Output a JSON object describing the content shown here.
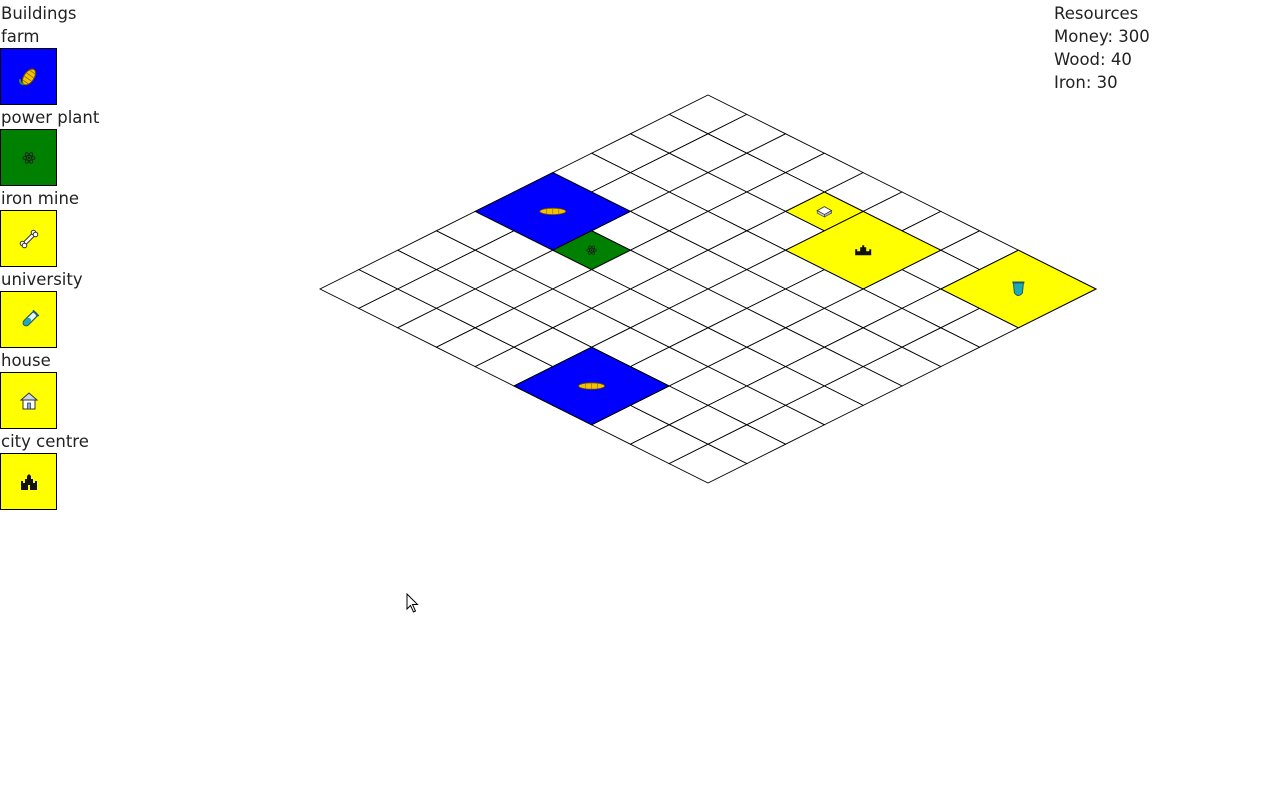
{
  "buildings": {
    "title": "Buildings",
    "items": [
      {
        "key": "farm",
        "label": "farm",
        "color": "#0000ff",
        "icon": "corn-icon"
      },
      {
        "key": "power-plant",
        "label": "power plant",
        "color": "#008000",
        "icon": "atom-icon"
      },
      {
        "key": "iron-mine",
        "label": "iron mine",
        "color": "#ffff00",
        "icon": "bone-icon"
      },
      {
        "key": "university",
        "label": "university",
        "color": "#ffff00",
        "icon": "test-tube-icon"
      },
      {
        "key": "house",
        "label": "house",
        "color": "#ffff00",
        "icon": "house-icon"
      },
      {
        "key": "city-centre",
        "label": "city centre",
        "color": "#ffff00",
        "icon": "castle-icon"
      }
    ]
  },
  "resources": {
    "title": "Resources",
    "money": "Money: 300",
    "wood": "Wood: 40",
    "iron": "Iron: 30"
  },
  "board": {
    "grid_size": 10,
    "placed": [
      {
        "building": "farm",
        "row": 4,
        "col": 0,
        "span": 2
      },
      {
        "building": "power-plant",
        "row": 5,
        "col": 2,
        "span": 1
      },
      {
        "building": "house",
        "row": 1,
        "col": 4,
        "span": 1
      },
      {
        "building": "city-centre",
        "row": 1,
        "col": 5,
        "span": 2
      },
      {
        "building": "university",
        "row": 0,
        "col": 8,
        "span": 2
      },
      {
        "building": "farm",
        "row": 8,
        "col": 5,
        "span": 2
      }
    ]
  }
}
